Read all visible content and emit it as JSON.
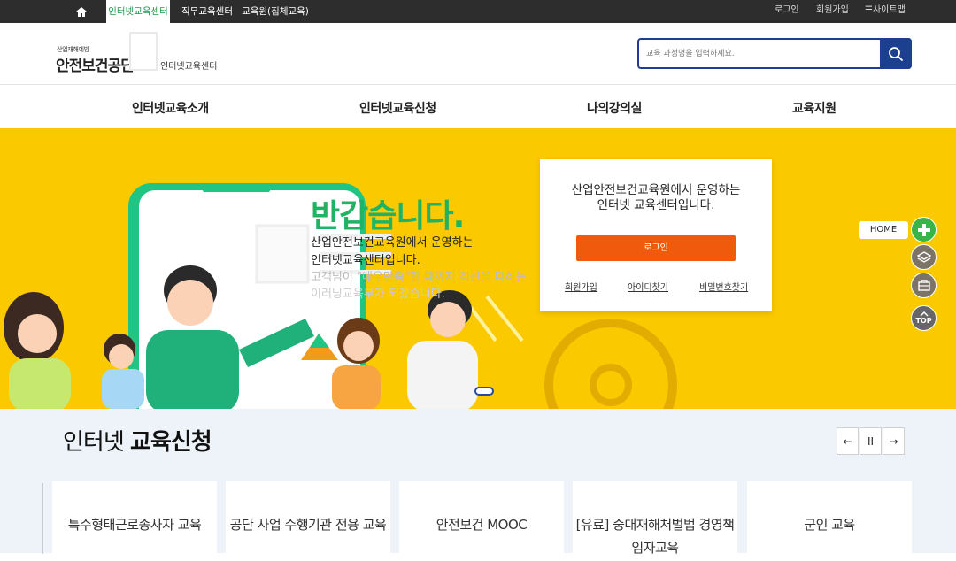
{
  "topbar": {
    "tabs": [
      "인터넷교육센터",
      "직무교육센터",
      "교육원(집체교육)"
    ],
    "right_links": [
      "로그인",
      "회원가입",
      "☰사이트맵"
    ]
  },
  "header": {
    "logo_small": "산업재해예방",
    "logo_main": "안전보건공단",
    "logo_sub": "인터넷교육센터",
    "search_placeholder": "교육 과정명을 입력하세요."
  },
  "nav": [
    "인터넷교육소개",
    "인터넷교육신청",
    "나의강의실",
    "교육지원"
  ],
  "banner": {
    "greeting": "반갑습니다.",
    "line1": "산업안전보건교육원에서 운영하는",
    "line2": "인터넷교육센터입니다.",
    "line3": "고객님이 \"매우만족\"할 때까지 최선을 다하는",
    "line4": "이러닝교육부가 되겠습니다."
  },
  "login_card": {
    "message_line1": "산업안전보건교육원에서 운영하는",
    "message_line2": "인터넷 교육센터입니다.",
    "login_label": "로그인",
    "links": [
      "회원가입",
      "아이디찾기",
      "비밀번호찾기"
    ]
  },
  "quick_menu": {
    "home_label": "HOME",
    "top_label": "TOP",
    "icons": [
      "plus-icon",
      "layers-icon",
      "book-icon",
      "top-icon"
    ]
  },
  "section": {
    "title_normal": "인터넷",
    "title_bold": "교육신청",
    "controls": [
      "←",
      "II",
      "→"
    ],
    "cards": [
      "특수형태근로종사자 교육",
      "공단 사업 수행기관 전용 교육",
      "안전보건 MOOC",
      "[유료] 중대재해처벌법 경영책임자교육",
      "군인 교육"
    ]
  },
  "colors": {
    "banner_bg": "#fbc900",
    "accent_green": "#1fb363",
    "login_orange": "#ef5a0c",
    "search_blue": "#1d3f8f"
  }
}
